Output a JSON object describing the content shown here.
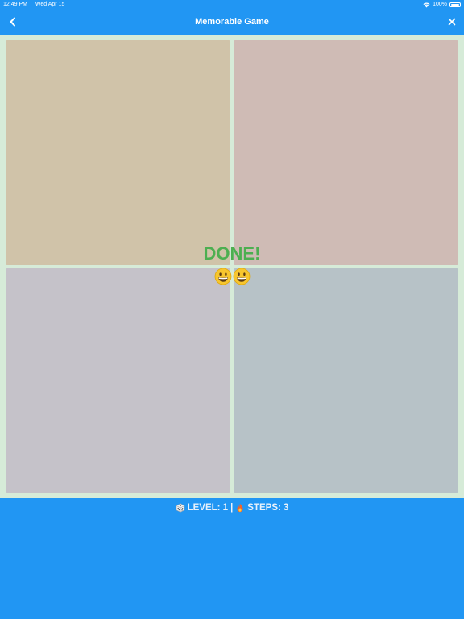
{
  "status_bar": {
    "time": "12:49 PM",
    "date": "Wed Apr 15",
    "battery": "100%"
  },
  "nav": {
    "title": "Memorable Game",
    "back_icon": "chevron-left-icon",
    "close_icon": "close-icon"
  },
  "board": {
    "tiles": [
      {
        "color": "#d0c3a9"
      },
      {
        "color": "#cfbbb5"
      },
      {
        "color": "#c5c2c9"
      },
      {
        "color": "#b7c2c7"
      }
    ],
    "done_text": "DONE!",
    "emoji": "grinning-face-icon"
  },
  "footer": {
    "level_label": "LEVEL: 1",
    "separator": "|",
    "steps_label": "STEPS: 3"
  },
  "colors": {
    "accent": "#2196f3",
    "board_bg": "#d6ebd8",
    "done": "#4caf50"
  }
}
